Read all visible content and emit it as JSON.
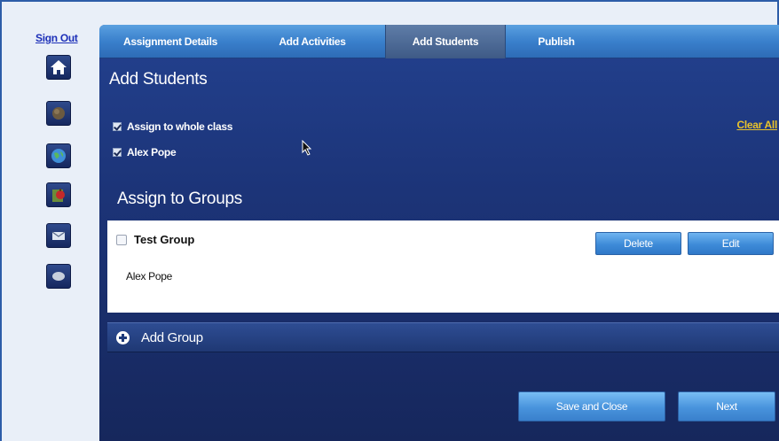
{
  "sidebar": {
    "sign_out": "Sign Out",
    "icons": [
      "home-icon",
      "ball-icon",
      "globe-icon",
      "book-apple-icon",
      "mail-icon",
      "chat-bubble-icon"
    ]
  },
  "tabs": [
    {
      "label": "Assignment Details",
      "active": false
    },
    {
      "label": "Add Activities",
      "active": false
    },
    {
      "label": "Add Students",
      "active": true
    },
    {
      "label": "Publish",
      "active": false
    }
  ],
  "add_students": {
    "title": "Add Students",
    "checkboxes": [
      {
        "label": "Assign to whole class",
        "checked": true
      },
      {
        "label": "Alex Pope",
        "checked": true
      }
    ],
    "clear_all": "Clear All"
  },
  "groups": {
    "title": "Assign to Groups",
    "items": [
      {
        "name": "Test Group",
        "checked": false,
        "members": [
          "Alex Pope"
        ]
      }
    ],
    "delete_label": "Delete",
    "edit_label": "Edit",
    "add_group_label": "Add Group"
  },
  "footer": {
    "save_close_label": "Save and Close",
    "next_label": "Next"
  },
  "colors": {
    "panel_bg": "#1c3478",
    "tab_bar": "#3a80cc",
    "link_yellow": "#e9c32b",
    "sign_out_blue": "#1c2fb8"
  }
}
